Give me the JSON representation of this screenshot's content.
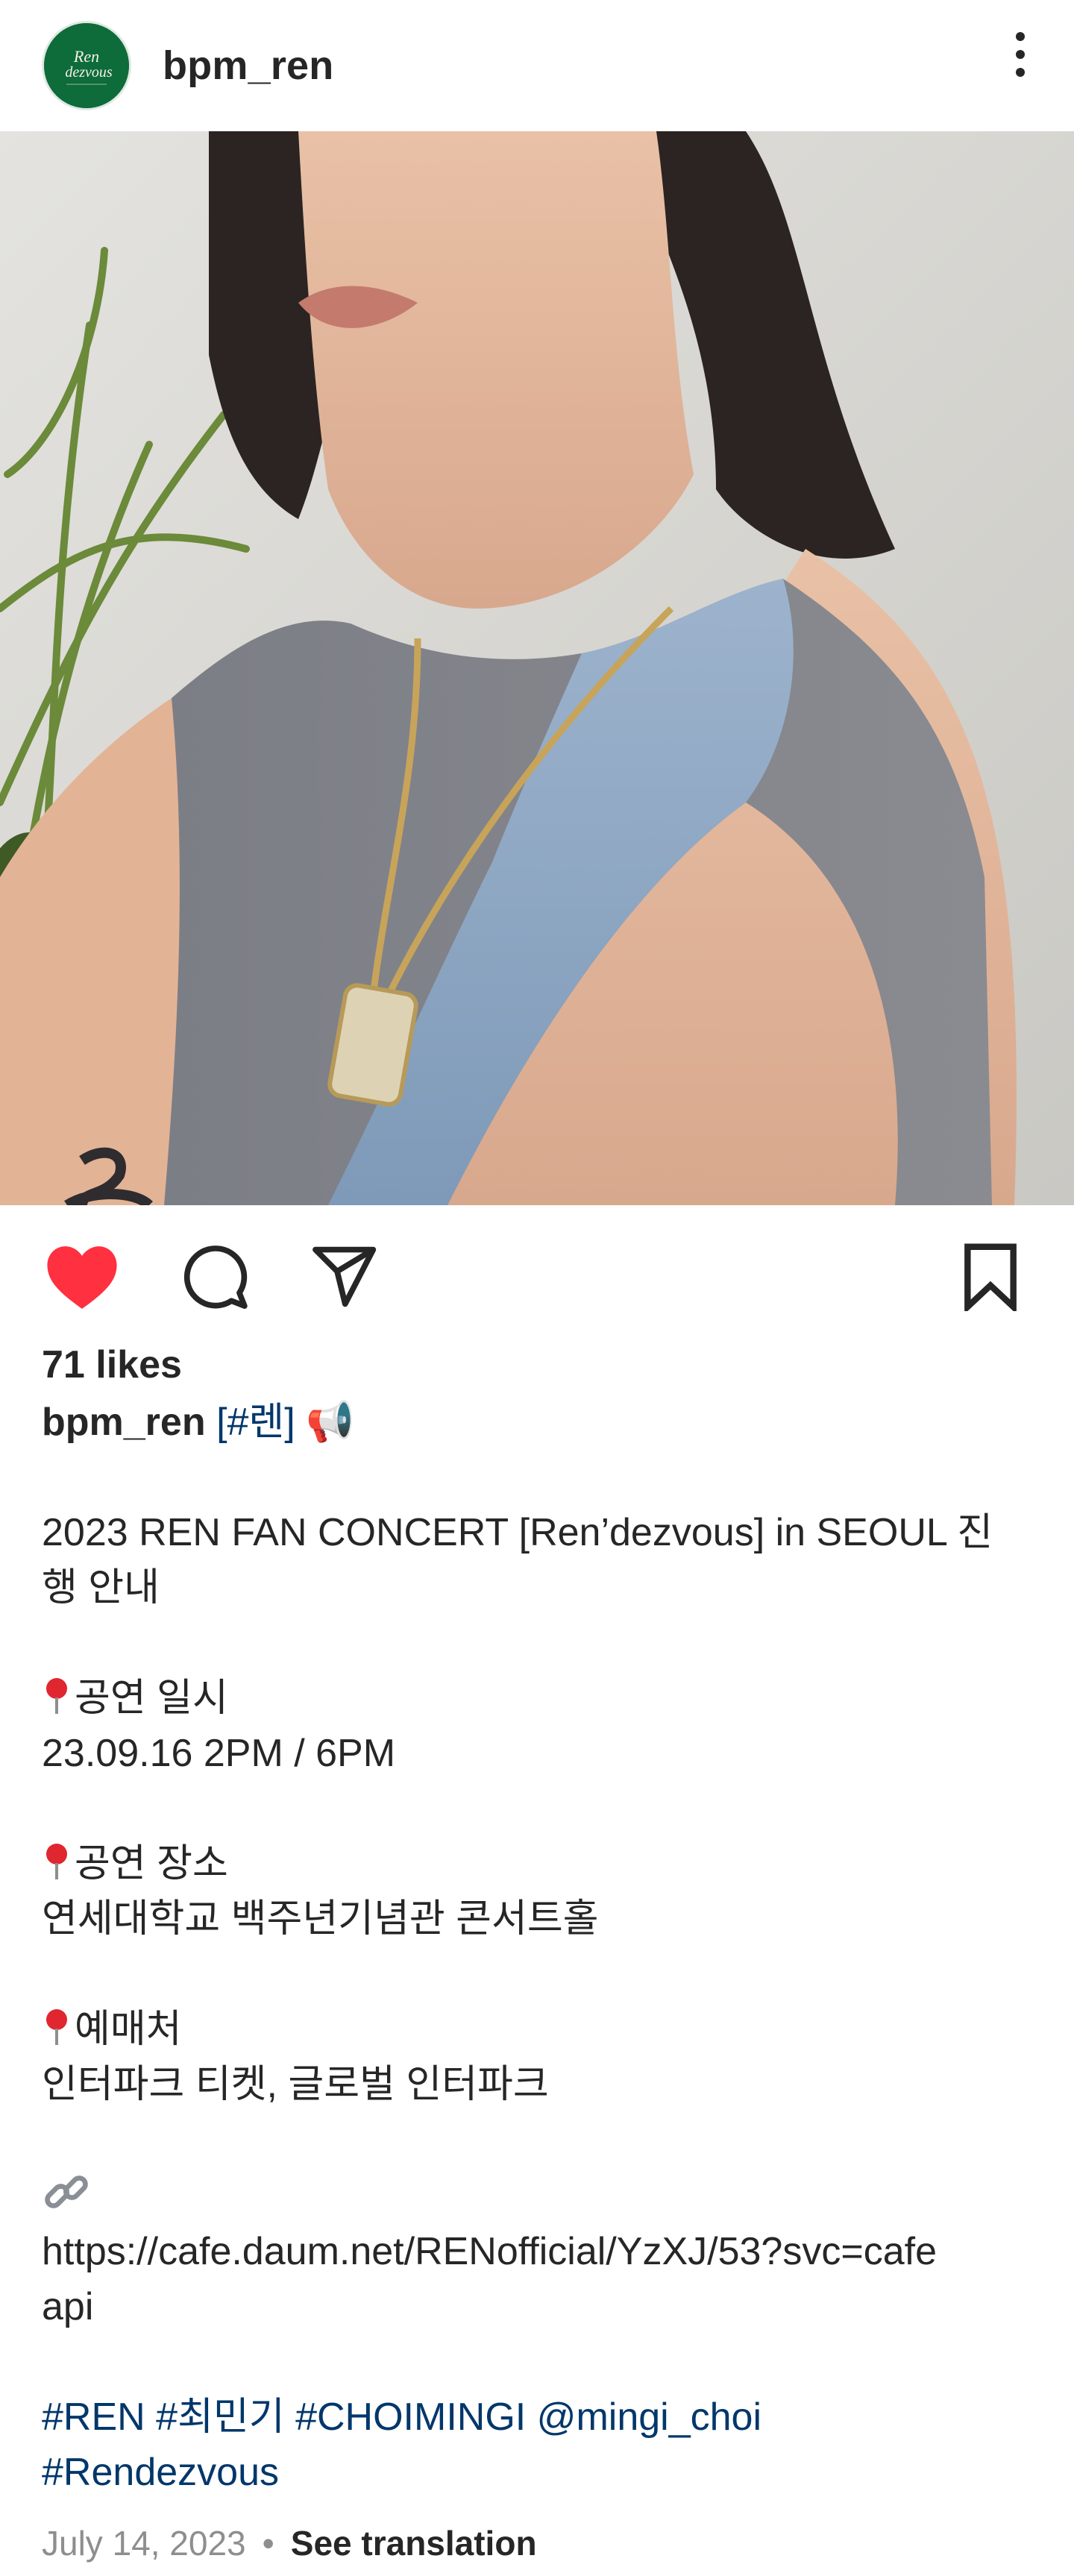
{
  "header": {
    "username": "bpm_ren",
    "avatar_text": "Ren dezvous",
    "more_icon": "more-vertical-icon"
  },
  "post": {
    "image_description_icon": "photo",
    "colors": {
      "like_red": "#ff3040",
      "link_blue": "#00376b",
      "meta_gray": "#8e8e8e"
    }
  },
  "actions": {
    "like_icon": "heart-filled-icon",
    "comment_icon": "comment-icon",
    "share_icon": "send-icon",
    "save_icon": "bookmark-icon"
  },
  "likes": "71 likes",
  "caption": {
    "username": "bpm_ren",
    "head_tag": "[#렌]",
    "head_emoji": "📢",
    "title_line1": "2023 REN FAN CONCERT [Ren’dezvous] in SEOUL 진",
    "title_line2": "행 안내",
    "date_label": "공연 일시",
    "date_value": "23.09.16 2PM / 6PM",
    "venue_label": "공연 장소",
    "venue_value": "연세대학교 백주년기념관 콘서트홀",
    "ticket_label": "예매처",
    "ticket_value": "인터파크 티켓, 글로벌 인터파크",
    "link_line1": "https://cafe.daum.net/RENofficial/YzXJ/53?svc=cafe",
    "link_line2": "api",
    "tags_line1": [
      "#REN",
      "#최민기",
      "#CHOIMINGI",
      "@mingi_choi"
    ],
    "tags_line2": [
      "#Rendezvous"
    ]
  },
  "meta": {
    "date": "July 14, 2023",
    "separator": "•",
    "see_translation": "See translation"
  }
}
